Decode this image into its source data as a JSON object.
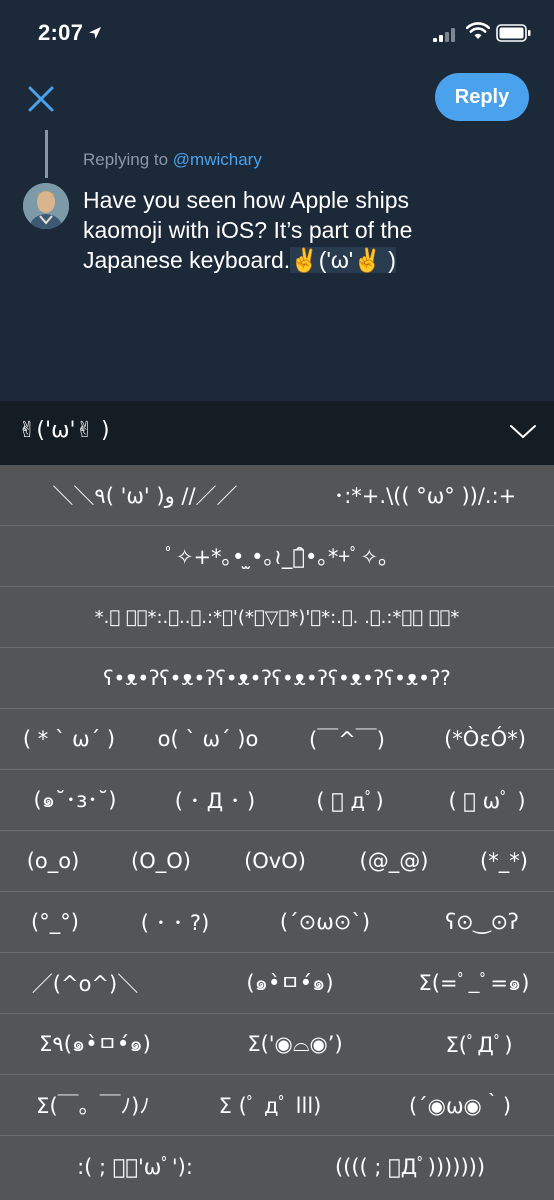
{
  "status_bar": {
    "time": "2:07"
  },
  "nav": {
    "reply_label": "Reply"
  },
  "compose": {
    "replying_prefix": "Replying to ",
    "replying_handle": "@mwichary",
    "text_lines": [
      "Have you seen how Apple ships",
      "kaomoji with iOS? It’s part of the",
      "Japanese keyboard."
    ],
    "selected_kaomoji": "✌('ω'✌ )"
  },
  "candidate_bar": {
    "current": "✌('ω'✌ )"
  },
  "kaomoji_rows": [
    [
      "＼＼٩( 'ω' )و //／／",
      "･:*+.\\(( °ω° ))/.:+"
    ],
    [
      "ﾟ✧+*｡• ̫•｡≀_･̑̑•｡*+ﾟ✧｡"
    ],
    [
      "*.ﾟ ﾟ･*:.｡..｡.:*･'(*ﾟ▽ﾟ*)'･*:.｡. .｡.:*･ﾟ ﾟ･*"
    ],
    [
      "ʕ•ᴥ•ʔʕ•ᴥ•ʔʕ•ᴥ•ʔʕ•ᴥ•ʔʕ•ᴥ•ʔʕ•ᴥ•ʔ?"
    ],
    [
      "( * ` ω´ )",
      "o( ` ω´ )o",
      "(￣^￣)",
      "(*ÒεÓ*)"
    ],
    [
      "(๑˘･з･˘)",
      "( ･ Д ･ )",
      "( ﾟ дﾟ)",
      "( ﾟ ωﾟ )"
    ],
    [
      "(o_o)",
      "(O_O)",
      "(OvO)",
      "(@_@)",
      "(*_*)"
    ],
    [
      "(°_°)",
      "( ･ ･ ?)",
      "(´⊙ω⊙`)",
      "ʕ⊙‿⊙ʔ"
    ],
    [
      "／(^o^)＼",
      "(๑•̀ㅁ•́๑)",
      "Σ(=ﾟ_ﾟ=๑)"
    ],
    [
      "Σ٩(๑•̀ㅁ•́๑)",
      "Σ('◉⌓◉’)",
      "Σ(ﾟДﾟ)"
    ],
    [
      "Σ(￣。￣ﾉ)ﾉ",
      "Σ (ﾟ дﾟ lll)",
      "(´◉ω◉｀)"
    ],
    [
      ":( ; ﾞﾟ'ωﾟ'):",
      "(((( ; ﾟДﾟ)))))))"
    ]
  ]
}
